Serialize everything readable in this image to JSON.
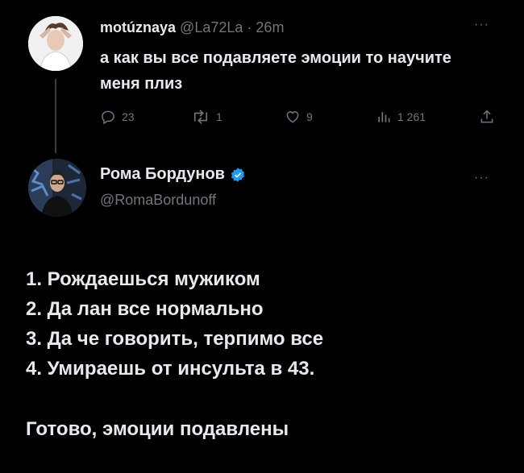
{
  "tweet1": {
    "author_name": "motúznaya",
    "author_handle": "@La72La",
    "separator": "·",
    "time": "26m",
    "text": "а как вы все подавляете эмоции то научите меня плиз",
    "replies": "23",
    "retweets": "1",
    "likes": "9",
    "views": "1 261"
  },
  "tweet2": {
    "author_name": "Рома Бордунов",
    "author_handle": "@RomaBordunoff",
    "verified_color": "#1d9bf0",
    "lines": [
      "1. Рождаешься мужиком",
      "2. Да лан все нормально",
      "3. Да че говорить, терпимо все",
      "4. Умираешь от инсульта в 43."
    ],
    "closing": "Готово, эмоции подавлены"
  },
  "icons": {
    "reply": "reply-icon",
    "retweet": "retweet-icon",
    "like": "heart-icon",
    "views": "views-icon",
    "share": "share-icon",
    "more": "more-icon",
    "verified": "verified-badge-icon"
  }
}
